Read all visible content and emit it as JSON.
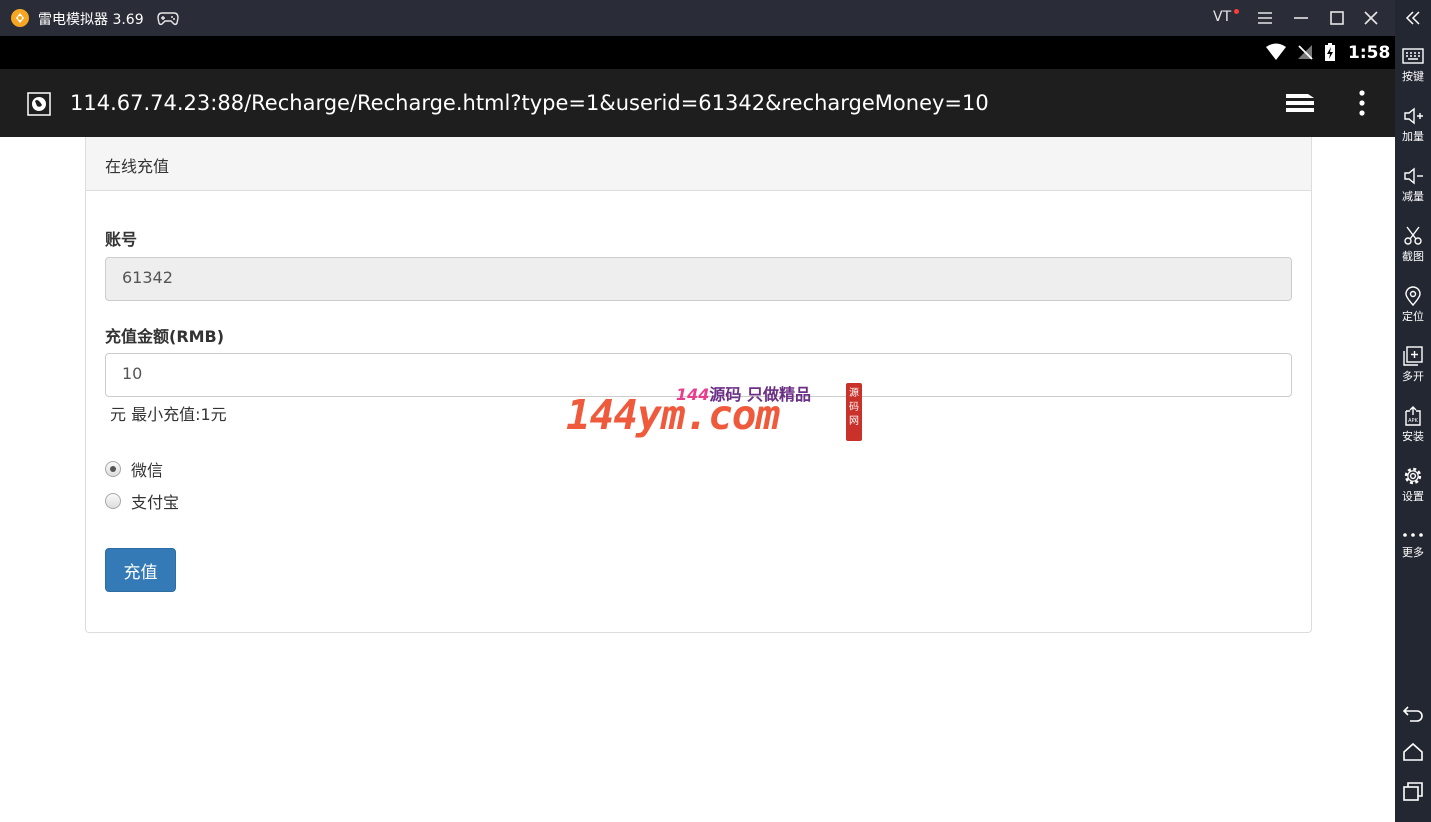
{
  "titlebar": {
    "app_title": "雷电模拟器 3.69",
    "vt_label": "VT"
  },
  "statusbar": {
    "time": "1:58"
  },
  "browser": {
    "url": "114.67.74.23:88/Recharge/Recharge.html?type=1&userid=61342&rechargeMoney=10"
  },
  "panel": {
    "heading": "在线充值",
    "account_label": "账号",
    "account_value": "61342",
    "amount_label": "充值金额(RMB)",
    "amount_value": "10",
    "amount_hint": "元 最小充值:1元",
    "payment_options": [
      {
        "label": "微信",
        "selected": true
      },
      {
        "label": "支付宝",
        "selected": false
      }
    ],
    "submit_label": "充值"
  },
  "watermark": {
    "big": "144ym.com",
    "small_pink": "144",
    "small_rest": "源码 只做精品",
    "seal": "源码网"
  },
  "sidebar": {
    "items": [
      {
        "label": "按键",
        "icon": "keyboard-icon"
      },
      {
        "label": "加量",
        "icon": "volume-up-icon"
      },
      {
        "label": "减量",
        "icon": "volume-down-icon"
      },
      {
        "label": "截图",
        "icon": "scissors-icon"
      },
      {
        "label": "定位",
        "icon": "location-pin-icon"
      },
      {
        "label": "多开",
        "icon": "multi-instance-icon"
      },
      {
        "label": "安装",
        "icon": "apk-install-icon"
      },
      {
        "label": "设置",
        "icon": "gear-icon"
      },
      {
        "label": "更多",
        "icon": "more-dots-icon"
      }
    ]
  },
  "colors": {
    "primary_button": "#337ab7",
    "watermark_orange": "#f05a3c",
    "watermark_purple": "#6b2f86"
  }
}
